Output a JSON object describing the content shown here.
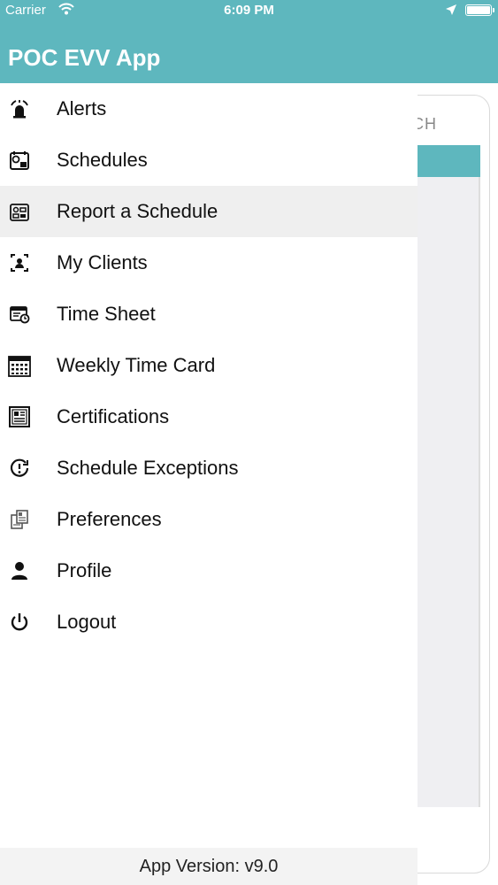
{
  "status_bar": {
    "carrier": "Carrier",
    "time": "6:09 PM"
  },
  "header": {
    "title": "POC EVV App",
    "color": "#5eb7be"
  },
  "background_screen": {
    "search_label": "CH"
  },
  "menu": {
    "items": [
      {
        "label": "Alerts",
        "icon": "alarm-icon"
      },
      {
        "label": "Schedules",
        "icon": "schedule-icon"
      },
      {
        "label": "Report a Schedule",
        "icon": "report-schedule-icon",
        "selected": true
      },
      {
        "label": "My Clients",
        "icon": "clients-icon"
      },
      {
        "label": "Time Sheet",
        "icon": "timesheet-icon"
      },
      {
        "label": "Weekly Time Card",
        "icon": "calendar-icon"
      },
      {
        "label": "Certifications",
        "icon": "certificate-icon"
      },
      {
        "label": "Schedule Exceptions",
        "icon": "exception-icon"
      },
      {
        "label": "Preferences",
        "icon": "preferences-icon"
      },
      {
        "label": "Profile",
        "icon": "person-icon"
      },
      {
        "label": "Logout",
        "icon": "power-icon"
      }
    ]
  },
  "footer": {
    "version": "App Version: v9.0"
  }
}
